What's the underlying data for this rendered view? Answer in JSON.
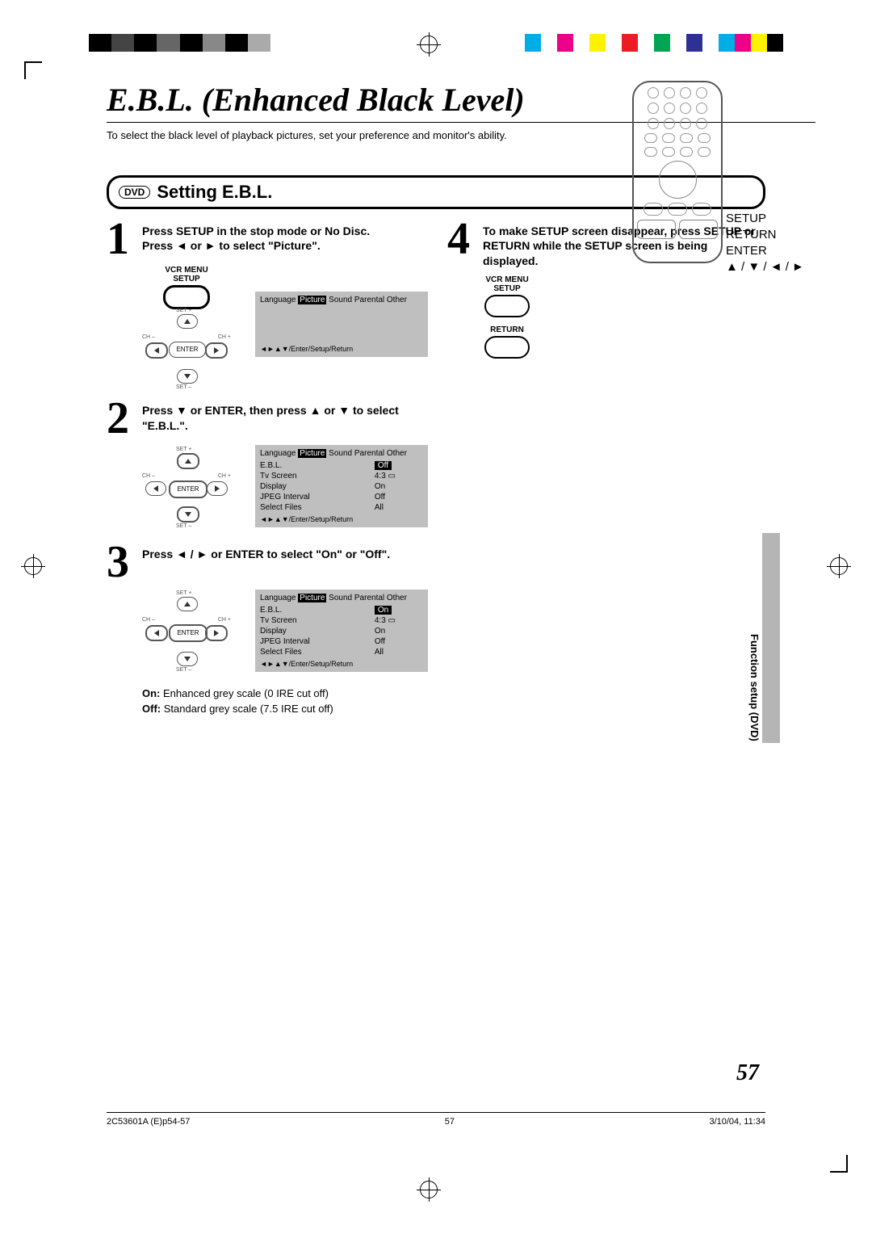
{
  "page": {
    "title": "E.B.L. (Enhanced Black Level)",
    "subtitle": "To select the black level of playback pictures, set your preference and monitor's ability.",
    "section_badge": "DVD",
    "section_title": "Setting E.B.L.",
    "side_tab": "Function setup (DVD)",
    "page_number": "57"
  },
  "remote_labels": {
    "setup": "SETUP",
    "return": "RETURN",
    "enter": "ENTER",
    "arrows": "▲ / ▼ / ◄ / ►"
  },
  "steps": {
    "s1": {
      "num": "1",
      "text_a": "Press SETUP in the stop mode or No Disc.",
      "text_b": "Press ◄ or ► to select \"Picture\".",
      "btn_top": "VCR MENU",
      "btn_bottom": "SETUP"
    },
    "s2": {
      "num": "2",
      "text": "Press ▼ or ENTER, then press ▲ or ▼ to select \"E.B.L.\"."
    },
    "s3": {
      "num": "3",
      "text": "Press ◄ / ► or ENTER to select \"On\" or \"Off\"."
    },
    "s4": {
      "num": "4",
      "text": "To make SETUP screen disappear, press SETUP or RETURN while the SETUP screen is being displayed.",
      "btn1_top": "VCR MENU",
      "btn1_bottom": "SETUP",
      "btn2": "RETURN"
    }
  },
  "osd": {
    "tabs": "Language Picture Sound Parental Other",
    "tab_selected": "Picture",
    "footer": "◄►▲▼/Enter/Setup/Return",
    "rows": [
      {
        "label": "E.B.L.",
        "off": "Off",
        "on": "On"
      },
      {
        "label": "Tv Screen",
        "val": "4:3 ▭"
      },
      {
        "label": "Display",
        "val": "On"
      },
      {
        "label": "JPEG Interval",
        "val": "Off"
      },
      {
        "label": "Select Files",
        "val": "All"
      }
    ]
  },
  "explain": {
    "on_label": "On:",
    "on_text": " Enhanced grey scale (0 IRE cut off)",
    "off_label": "Off:",
    "off_text": " Standard grey scale (7.5 IRE cut off)"
  },
  "dpad": {
    "enter": "ENTER",
    "set_plus": "SET +",
    "set_minus": "SET –",
    "ch_plus": "CH +",
    "ch_minus": "CH –"
  },
  "footer": {
    "left": "2C53601A (E)p54-57",
    "center": "57",
    "right": "3/10/04, 11:34"
  }
}
